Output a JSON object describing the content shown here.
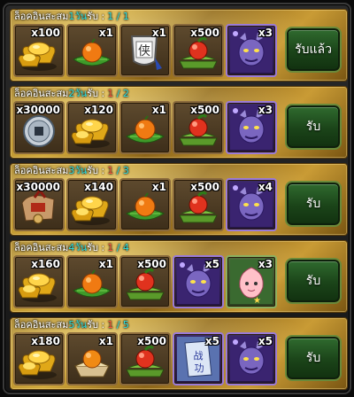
{
  "rows": [
    {
      "title_pre": "ล็อคอินสะสม",
      "day_label": "1วัน",
      "title_post": "รับ :",
      "progress_current": "1",
      "progress_total": "/ 1",
      "claimed": true,
      "button_label": "รับแล้ว",
      "items": [
        {
          "qty": "x100",
          "icon": "gold-ingot-icon"
        },
        {
          "qty": "x1",
          "icon": "orange-on-leaf-icon"
        },
        {
          "qty": "x1",
          "icon": "silver-token-icon"
        },
        {
          "qty": "x500",
          "icon": "peach-on-tray-icon"
        },
        {
          "qty": "x3",
          "icon": "demon-portrait-icon"
        }
      ]
    },
    {
      "title_pre": "ล็อคอินสะสม",
      "day_label": "2วัน",
      "title_post": "รับ :",
      "progress_current": "1",
      "progress_total": "/ 2",
      "claimed": false,
      "button_label": "รับ",
      "items": [
        {
          "qty": "x30000",
          "icon": "copper-coin-icon"
        },
        {
          "qty": "x120",
          "icon": "gold-ingot-icon"
        },
        {
          "qty": "x1",
          "icon": "orange-on-leaf-icon"
        },
        {
          "qty": "x500",
          "icon": "peach-on-tray-icon"
        },
        {
          "qty": "x3",
          "icon": "demon-portrait-icon"
        }
      ]
    },
    {
      "title_pre": "ล็อคอินสะสม",
      "day_label": "3วัน",
      "title_post": "รับ :",
      "progress_current": "1",
      "progress_total": "/ 3",
      "claimed": false,
      "button_label": "รับ",
      "items": [
        {
          "qty": "x30000",
          "icon": "money-bag-icon"
        },
        {
          "qty": "x140",
          "icon": "gold-ingot-icon"
        },
        {
          "qty": "x1",
          "icon": "orange-on-leaf-icon"
        },
        {
          "qty": "x500",
          "icon": "peach-on-tray-icon"
        },
        {
          "qty": "x4",
          "icon": "demon-portrait-icon"
        }
      ]
    },
    {
      "title_pre": "ล็อคอินสะสม",
      "day_label": "4วัน",
      "title_post": "รับ :",
      "progress_current": "1",
      "progress_total": "/ 4",
      "claimed": false,
      "button_label": "รับ",
      "items": [
        {
          "qty": "x160",
          "icon": "gold-ingot-icon"
        },
        {
          "qty": "x1",
          "icon": "orange-on-leaf-icon"
        },
        {
          "qty": "x500",
          "icon": "peach-on-tray-icon"
        },
        {
          "qty": "x5",
          "icon": "demon-portrait-icon"
        },
        {
          "qty": "x3",
          "icon": "pink-peach-icon"
        }
      ]
    },
    {
      "title_pre": "ล็อคอินสะสม",
      "day_label": "5วัน",
      "title_post": "รับ :",
      "progress_current": "1",
      "progress_total": "/ 5",
      "claimed": false,
      "button_label": "รับ",
      "items": [
        {
          "qty": "x180",
          "icon": "gold-ingot-icon"
        },
        {
          "qty": "x1",
          "icon": "orange-in-box-icon"
        },
        {
          "qty": "x500",
          "icon": "peach-on-tray-icon"
        },
        {
          "qty": "x5",
          "icon": "scroll-icon"
        },
        {
          "qty": "x5",
          "icon": "demon-portrait-icon"
        }
      ]
    }
  ]
}
